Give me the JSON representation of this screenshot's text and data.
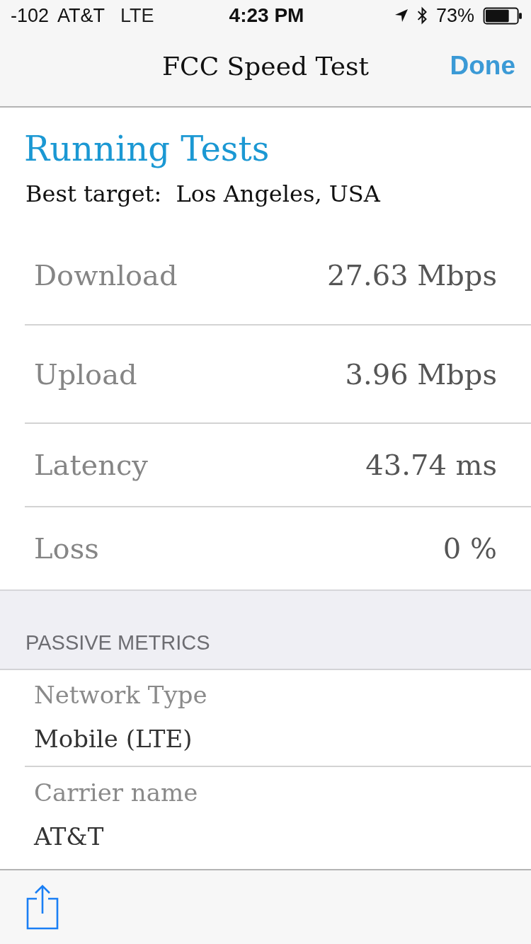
{
  "status_bar": {
    "signal": "-102",
    "carrier": "AT&T",
    "network": "LTE",
    "time": "4:23 PM",
    "battery": "73%"
  },
  "nav_bar": {
    "title": "FCC Speed Test",
    "done": "Done"
  },
  "tests": {
    "heading": "Running Tests",
    "target": "Best target:  Los Angeles, USA",
    "results": [
      {
        "label": "Download",
        "value": "27.63 Mbps"
      },
      {
        "label": "Upload",
        "value": "3.96 Mbps"
      },
      {
        "label": "Latency",
        "value": "43.74 ms"
      },
      {
        "label": "Loss",
        "value": "0 %"
      }
    ]
  },
  "passive_metrics": {
    "header": "PASSIVE METRICS",
    "items": [
      {
        "label": "Network Type",
        "value": "Mobile (LTE)"
      },
      {
        "label": "Carrier name",
        "value": "AT&T"
      }
    ]
  }
}
